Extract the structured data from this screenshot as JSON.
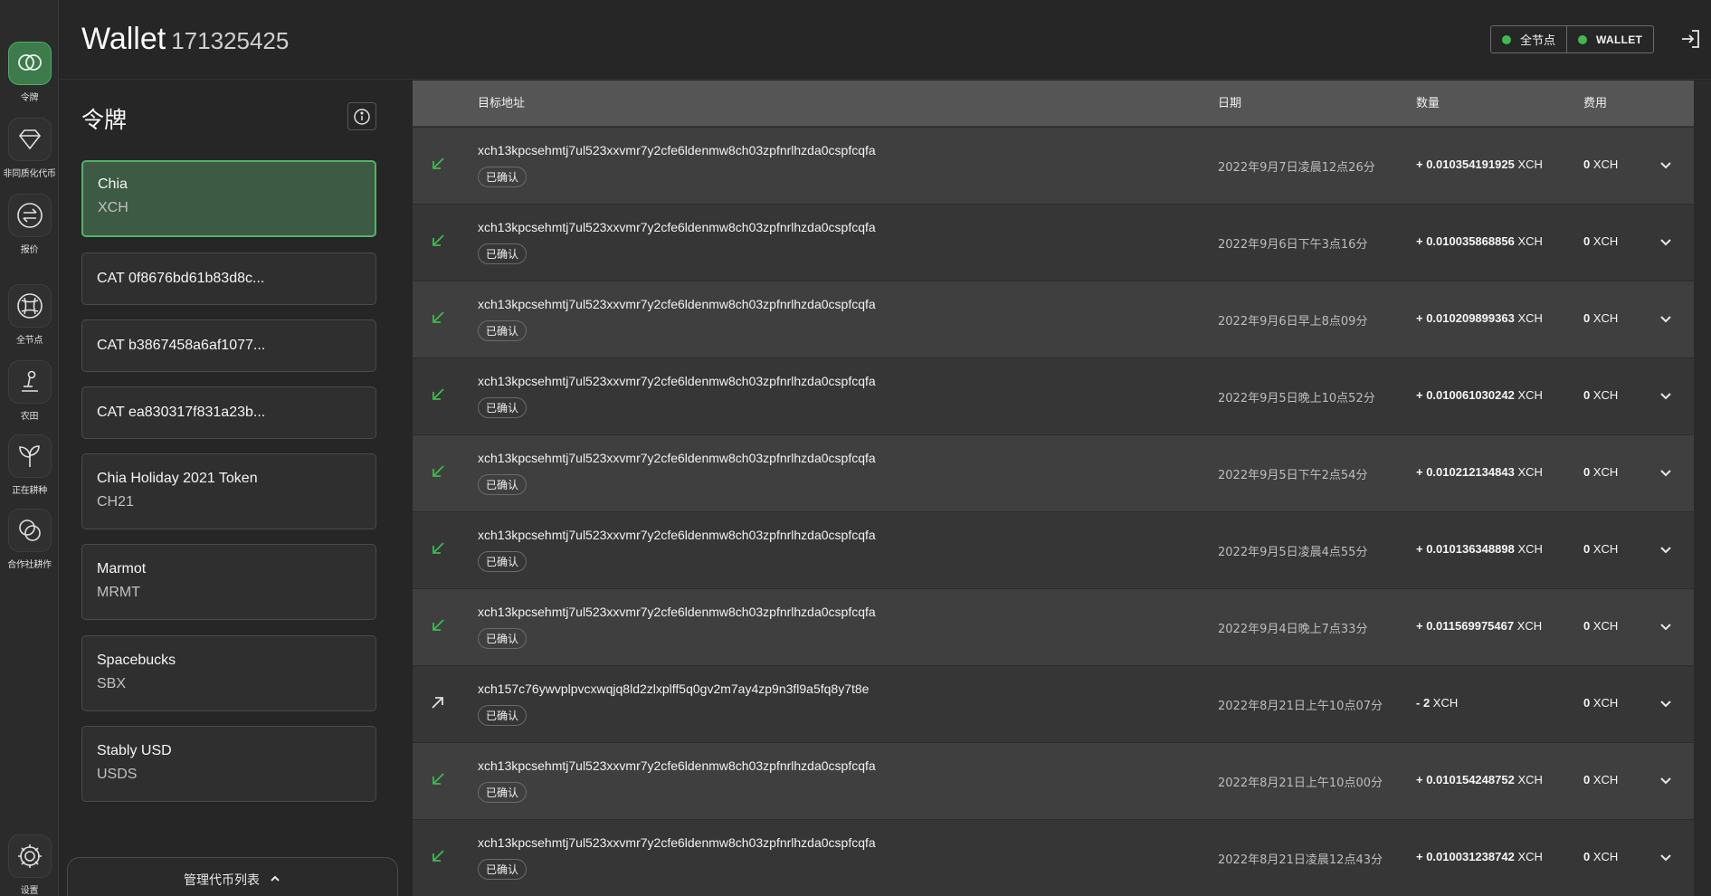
{
  "header": {
    "title": "Wallet",
    "wallet_id": "171325425",
    "status_full_node": "全节点",
    "status_wallet": "WALLET",
    "logout_icon": "logout-icon"
  },
  "nav": {
    "items": [
      {
        "label": "令牌",
        "icon": "tokens-icon"
      },
      {
        "label": "非同质化代币",
        "icon": "nft-icon"
      },
      {
        "label": "报价",
        "icon": "offers-icon"
      },
      {
        "label": "全节点",
        "icon": "full-node-icon"
      },
      {
        "label": "农田",
        "icon": "farm-icon"
      },
      {
        "label": "正在耕种",
        "icon": "plotting-icon"
      },
      {
        "label": "合作社耕作",
        "icon": "pool-icon"
      },
      {
        "label": "设置",
        "icon": "settings-icon"
      }
    ]
  },
  "tokens": {
    "title": "令牌",
    "manage_label": "管理代币列表",
    "items": [
      {
        "name": "Chia",
        "symbol": "XCH"
      },
      {
        "name": "CAT 0f8676bd61b83d8c...",
        "symbol": ""
      },
      {
        "name": "CAT b3867458a6af1077...",
        "symbol": ""
      },
      {
        "name": "CAT ea830317f831a23b...",
        "symbol": ""
      },
      {
        "name": "Chia Holiday 2021 Token",
        "symbol": "CH21"
      },
      {
        "name": "Marmot",
        "symbol": "MRMT"
      },
      {
        "name": "Spacebucks",
        "symbol": "SBX"
      },
      {
        "name": "Stably USD",
        "symbol": "USDS"
      }
    ]
  },
  "table": {
    "columns": [
      "目标地址",
      "日期",
      "数量",
      "费用"
    ],
    "rows": [
      {
        "direction": "incoming",
        "address": "xch13kpcsehmtj7ul523xxvmr7y2cfe6ldenmw8ch03zpfnrlhzda0cspfcqfa",
        "status": "已确认",
        "date": "2022年9月7日凌晨12点26分",
        "amount": "+ 0.010354191925",
        "unit": "XCH",
        "fee": "0",
        "fee_unit": "XCH"
      },
      {
        "direction": "incoming",
        "address": "xch13kpcsehmtj7ul523xxvmr7y2cfe6ldenmw8ch03zpfnrlhzda0cspfcqfa",
        "status": "已确认",
        "date": "2022年9月6日下午3点16分",
        "amount": "+ 0.010035868856",
        "unit": "XCH",
        "fee": "0",
        "fee_unit": "XCH"
      },
      {
        "direction": "incoming",
        "address": "xch13kpcsehmtj7ul523xxvmr7y2cfe6ldenmw8ch03zpfnrlhzda0cspfcqfa",
        "status": "已确认",
        "date": "2022年9月6日早上8点09分",
        "amount": "+ 0.010209899363",
        "unit": "XCH",
        "fee": "0",
        "fee_unit": "XCH"
      },
      {
        "direction": "incoming",
        "address": "xch13kpcsehmtj7ul523xxvmr7y2cfe6ldenmw8ch03zpfnrlhzda0cspfcqfa",
        "status": "已确认",
        "date": "2022年9月5日晚上10点52分",
        "amount": "+ 0.010061030242",
        "unit": "XCH",
        "fee": "0",
        "fee_unit": "XCH"
      },
      {
        "direction": "incoming",
        "address": "xch13kpcsehmtj7ul523xxvmr7y2cfe6ldenmw8ch03zpfnrlhzda0cspfcqfa",
        "status": "已确认",
        "date": "2022年9月5日下午2点54分",
        "amount": "+ 0.010212134843",
        "unit": "XCH",
        "fee": "0",
        "fee_unit": "XCH"
      },
      {
        "direction": "incoming",
        "address": "xch13kpcsehmtj7ul523xxvmr7y2cfe6ldenmw8ch03zpfnrlhzda0cspfcqfa",
        "status": "已确认",
        "date": "2022年9月5日凌晨4点55分",
        "amount": "+ 0.010136348898",
        "unit": "XCH",
        "fee": "0",
        "fee_unit": "XCH"
      },
      {
        "direction": "incoming",
        "address": "xch13kpcsehmtj7ul523xxvmr7y2cfe6ldenmw8ch03zpfnrlhzda0cspfcqfa",
        "status": "已确认",
        "date": "2022年9月4日晚上7点33分",
        "amount": "+ 0.011569975467",
        "unit": "XCH",
        "fee": "0",
        "fee_unit": "XCH"
      },
      {
        "direction": "outgoing",
        "address": "xch157c76ywvplpvcxwqjq8ld2zlxplff5q0gv2m7ay4zp9n3fl9a5fq8y7t8e",
        "status": "已确认",
        "date": "2022年8月21日上午10点07分",
        "amount": "- 2",
        "unit": "XCH",
        "fee": "0",
        "fee_unit": "XCH"
      },
      {
        "direction": "incoming",
        "address": "xch13kpcsehmtj7ul523xxvmr7y2cfe6ldenmw8ch03zpfnrlhzda0cspfcqfa",
        "status": "已确认",
        "date": "2022年8月21日上午10点00分",
        "amount": "+ 0.010154248752",
        "unit": "XCH",
        "fee": "0",
        "fee_unit": "XCH"
      },
      {
        "direction": "incoming",
        "address": "xch13kpcsehmtj7ul523xxvmr7y2cfe6ldenmw8ch03zpfnrlhzda0cspfcqfa",
        "status": "已确认",
        "date": "2022年8月21日凌晨12点43分",
        "amount": "+ 0.010031238742",
        "unit": "XCH",
        "fee": "0",
        "fee_unit": "XCH"
      }
    ]
  },
  "colors": {
    "accent": "#3fb950",
    "active_token_bg": "#3d5a44",
    "incoming_arrow": "#3fb950",
    "outgoing_arrow": "#e0e0e0"
  }
}
